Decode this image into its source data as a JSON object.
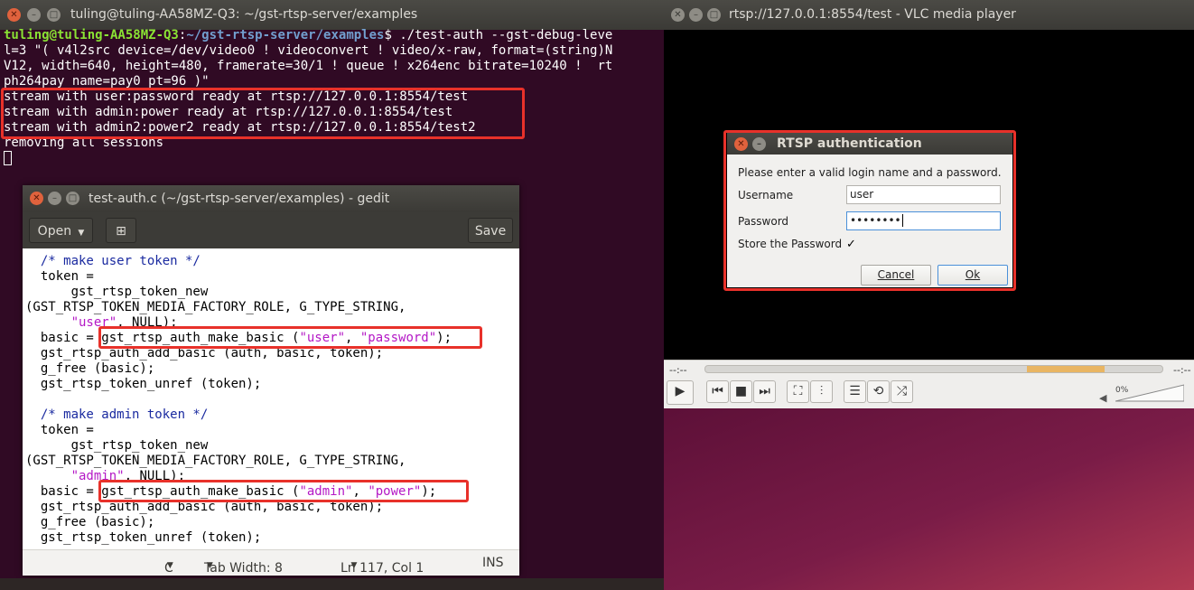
{
  "terminal": {
    "title": "tuling@tuling-AA58MZ-Q3: ~/gst-rtsp-server/examples",
    "prompt_user": "tuling@tuling-AA58MZ-Q3",
    "prompt_sep": ":",
    "prompt_path": "~/gst-rtsp-server/examples",
    "prompt_end": "$ ",
    "command_line1": "./test-auth --gst-debug-leve",
    "lines": [
      "l=3 \"( v4l2src device=/dev/video0 ! videoconvert ! video/x-raw, format=(string)N",
      "V12, width=640, height=480, framerate=30/1 ! queue ! x264enc bitrate=10240 !  rt",
      "ph264pay name=pay0 pt=96 )\"",
      "stream with user:password ready at rtsp://127.0.0.1:8554/test",
      "stream with admin:power ready at rtsp://127.0.0.1:8554/test",
      "stream with admin2:power2 ready at rtsp://127.0.0.1:8554/test2",
      "removing all sessions"
    ]
  },
  "gedit": {
    "title": "test-auth.c (~/gst-rtsp-server/examples) - gedit",
    "open_label": "Open",
    "save_label": "Save",
    "code": {
      "c1": "  /* make user token */",
      "l2": "  token =",
      "l3": "      gst_rtsp_token_new",
      "l4": "(GST_RTSP_TOKEN_MEDIA_FACTORY_ROLE, G_TYPE_STRING,",
      "l5s": "\"user\"",
      "l5e": ", NULL);",
      "l6a": "  basic = gst_rtsp_auth_make_basic (",
      "l6s1": "\"user\"",
      "l6m": ", ",
      "l6s2": "\"password\"",
      "l6e": ");",
      "l7": "  gst_rtsp_auth_add_basic (auth, basic, token);",
      "l8": "  g_free (basic);",
      "l9": "  gst_rtsp_token_unref (token);",
      "c2": "  /* make admin token */",
      "l11": "  token =",
      "l12": "      gst_rtsp_token_new",
      "l13": "(GST_RTSP_TOKEN_MEDIA_FACTORY_ROLE, G_TYPE_STRING,",
      "l14s": "\"admin\"",
      "l14e": ", NULL);",
      "l15a": "  basic = gst_rtsp_auth_make_basic (",
      "l15s1": "\"admin\"",
      "l15m": ", ",
      "l15s2": "\"power\"",
      "l15e": ");",
      "l16": "  gst_rtsp_auth_add_basic (auth, basic, token);",
      "l17": "  g_free (basic);",
      "l18": "  gst_rtsp_token_unref (token);"
    },
    "status": {
      "language": "C",
      "tab_width": "Tab Width: 8",
      "position": "Ln 117, Col 1",
      "mode": "INS"
    }
  },
  "vlc": {
    "title": "rtsp://127.0.0.1:8554/test - VLC media player",
    "time_elapsed": "--:--",
    "time_total": "--:--",
    "volume": "0%",
    "volume_level": 0,
    "buffer_fraction_start": 0.7,
    "buffer_fraction_end": 0.87
  },
  "dialog": {
    "title": "RTSP authentication",
    "message": "Please enter a valid login name and a password.",
    "username_label": "Username",
    "username_value": "user",
    "password_label": "Password",
    "password_value": "••••••••",
    "store_label": "Store the Password",
    "store_checked": true,
    "cancel_label": "Cancel",
    "ok_label": "Ok"
  },
  "colors": {
    "terminal_bg": "#300a24",
    "highlight": "#e8312a",
    "comment": "#1a2aa0",
    "string": "#b418c6"
  }
}
